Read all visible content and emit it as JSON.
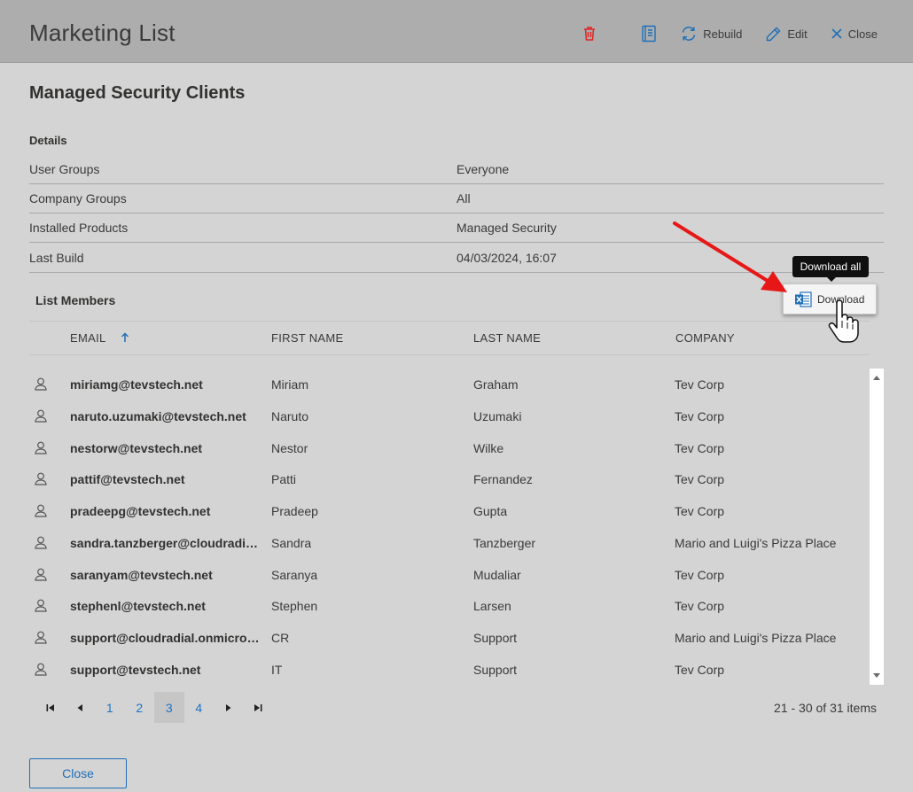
{
  "header": {
    "title": "Marketing List",
    "toolbar": {
      "rebuild_label": "Rebuild",
      "edit_label": "Edit",
      "close_label": "Close"
    }
  },
  "panel": {
    "title": "Managed Security Clients",
    "details_label": "Details",
    "details": [
      {
        "key": "User Groups",
        "value": "Everyone"
      },
      {
        "key": "Company Groups",
        "value": "All"
      },
      {
        "key": "Installed Products",
        "value": "Managed Security"
      },
      {
        "key": "Last Build",
        "value": "04/03/2024, 16:07"
      }
    ]
  },
  "members": {
    "label": "List Members",
    "download_label": "Download",
    "tooltip": "Download all",
    "columns": {
      "email": "EMAIL",
      "first_name": "FIRST NAME",
      "last_name": "LAST NAME",
      "company": "COMPANY"
    },
    "rows": [
      {
        "email": "miriamg@tevstech.net",
        "first": "Miriam",
        "last": "Graham",
        "company": "Tev Corp"
      },
      {
        "email": "naruto.uzumaki@tevstech.net",
        "first": "Naruto",
        "last": "Uzumaki",
        "company": "Tev Corp"
      },
      {
        "email": "nestorw@tevstech.net",
        "first": "Nestor",
        "last": "Wilke",
        "company": "Tev Corp"
      },
      {
        "email": "pattif@tevstech.net",
        "first": "Patti",
        "last": "Fernandez",
        "company": "Tev Corp"
      },
      {
        "email": "pradeepg@tevstech.net",
        "first": "Pradeep",
        "last": "Gupta",
        "company": "Tev Corp"
      },
      {
        "email": "sandra.tanzberger@cloudradia...",
        "first": "Sandra",
        "last": "Tanzberger",
        "company": "Mario and Luigi's Pizza Place"
      },
      {
        "email": "saranyam@tevstech.net",
        "first": "Saranya",
        "last": "Mudaliar",
        "company": "Tev Corp"
      },
      {
        "email": "stephenl@tevstech.net",
        "first": "Stephen",
        "last": "Larsen",
        "company": "Tev Corp"
      },
      {
        "email": "support@cloudradial.onmicros...",
        "first": "CR",
        "last": "Support",
        "company": "Mario and Luigi's Pizza Place"
      },
      {
        "email": "support@tevstech.net",
        "first": "IT",
        "last": "Support",
        "company": "Tev Corp"
      }
    ]
  },
  "pager": {
    "pages": [
      "1",
      "2",
      "3",
      "4"
    ],
    "current_page": "3",
    "info": "21 - 30 of 31 items"
  },
  "footer": {
    "close_label": "Close"
  },
  "colors": {
    "header_bg": "#adadad",
    "body_bg": "#d4d4d4",
    "accent": "#1f6fb8",
    "delete": "#e02424",
    "arrow": "#e81717"
  }
}
